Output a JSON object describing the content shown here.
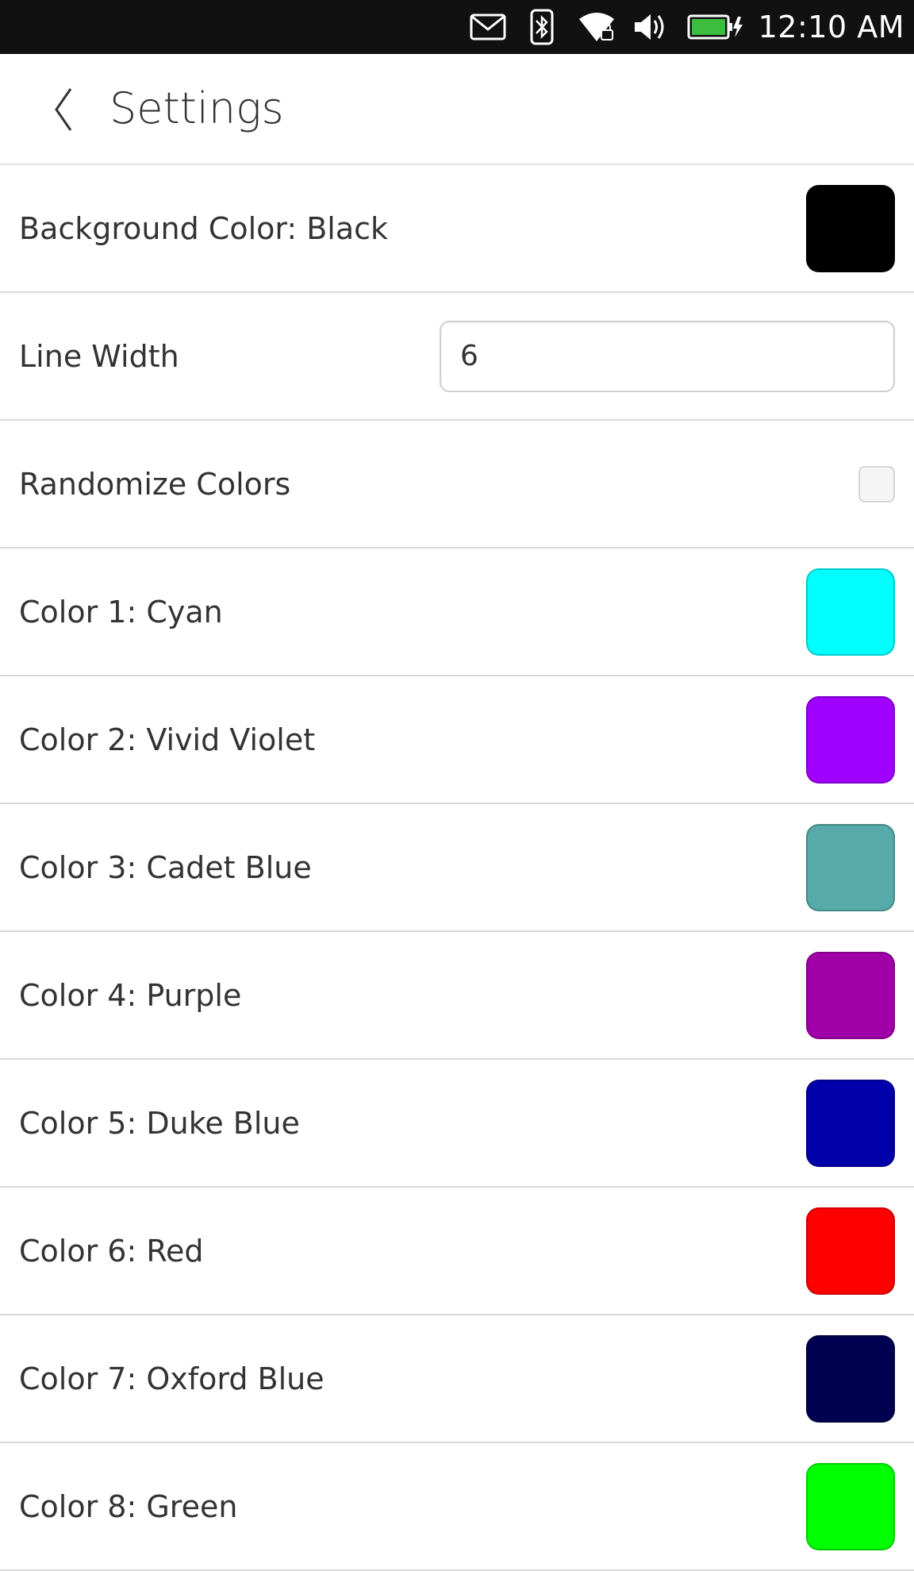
{
  "status_bar": {
    "time": "12:10 AM",
    "icons": [
      "mail-icon",
      "bluetooth-icon",
      "wifi-icon",
      "volume-icon",
      "battery-charging-icon"
    ]
  },
  "header": {
    "back_icon": "chevron-left-icon",
    "title": "Settings"
  },
  "settings": {
    "background": {
      "label": "Background Color: Black",
      "color": "#000000"
    },
    "line_width": {
      "label": "Line Width",
      "value": "6"
    },
    "randomize": {
      "label": "Randomize Colors",
      "checked": false
    },
    "colors": [
      {
        "label": "Color 1: Cyan",
        "color": "#00ffff"
      },
      {
        "label": "Color 2: Vivid Violet",
        "color": "#9f00ff"
      },
      {
        "label": "Color 3: Cadet Blue",
        "color": "#56aaaa"
      },
      {
        "label": "Color 4: Purple",
        "color": "#a000a8"
      },
      {
        "label": "Color 5: Duke Blue",
        "color": "#0000aa"
      },
      {
        "label": "Color 6: Red",
        "color": "#ff0000"
      },
      {
        "label": "Color 7: Oxford Blue",
        "color": "#000050"
      },
      {
        "label": "Color 8: Green",
        "color": "#00ff00"
      }
    ]
  }
}
